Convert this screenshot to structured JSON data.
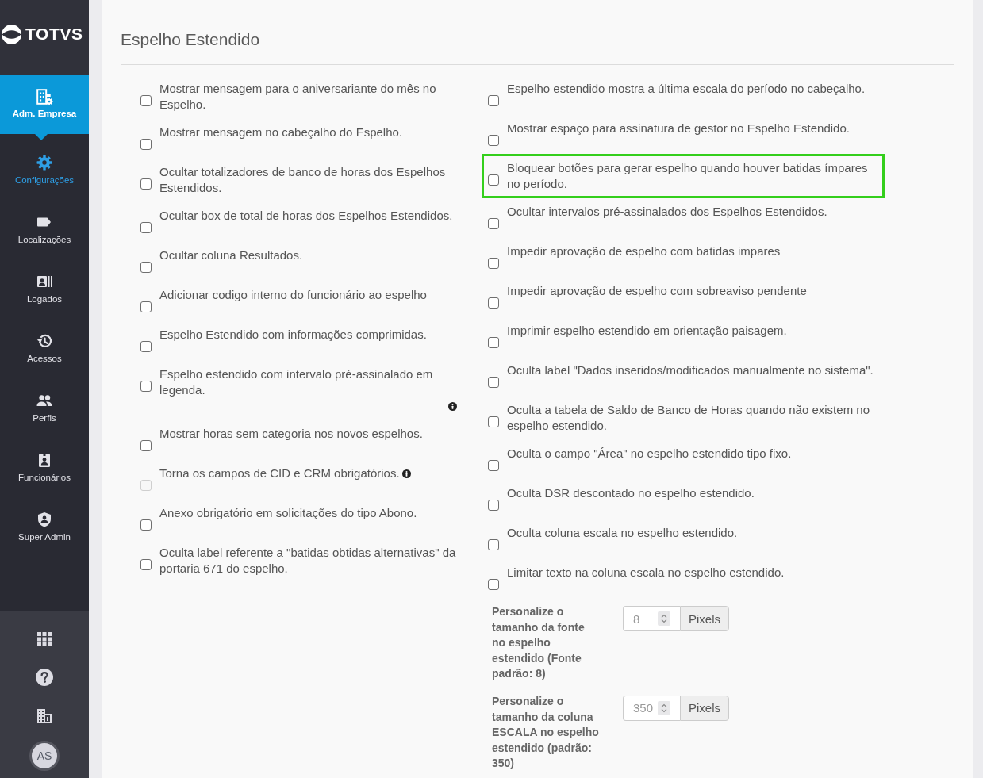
{
  "sidebar": {
    "logo": {
      "text": "TOTVS"
    },
    "section": {
      "label": "Adm. Empresa",
      "expanded": true
    },
    "items": [
      {
        "label": "Configurações",
        "selected": true
      },
      {
        "label": "Localizações",
        "selected": false
      },
      {
        "label": "Logados",
        "selected": false
      },
      {
        "label": "Acessos",
        "selected": false
      },
      {
        "label": "Perfis",
        "selected": false
      },
      {
        "label": "Funcionários",
        "selected": false
      },
      {
        "label": "Super Admin",
        "selected": false
      }
    ],
    "footer": {
      "avatar": "AS"
    }
  },
  "panel": {
    "title": "Espelho Estendido",
    "left_options": [
      {
        "label": "Mostrar mensagem para o aniversariante do mês no Espelho.",
        "checked": false,
        "disabled": false
      },
      {
        "label": "Mostrar mensagem no cabeçalho do Espelho.",
        "checked": false,
        "disabled": false
      },
      {
        "label": "Ocultar totalizadores de banco de horas dos Espelhos Estendidos.",
        "checked": false,
        "disabled": false
      },
      {
        "label": "Ocultar box de total de horas dos Espelhos Estendidos.",
        "checked": false,
        "disabled": false
      },
      {
        "label": "Ocultar coluna Resultados.",
        "checked": false,
        "disabled": false
      },
      {
        "label": "Adicionar codigo interno do funcionário ao espelho",
        "checked": false,
        "disabled": false
      },
      {
        "label": "Espelho Estendido com informações comprimidas.",
        "checked": false,
        "disabled": false
      },
      {
        "label": "Espelho estendido com intervalo pré-assinalado em legenda.",
        "checked": false,
        "disabled": false,
        "info_below": true
      },
      {
        "label": "Mostrar horas sem categoria nos novos espelhos.",
        "checked": false,
        "disabled": false
      },
      {
        "label": "Torna os campos de CID e CRM obrigatórios.",
        "checked": false,
        "disabled": true,
        "info_inline": true
      },
      {
        "label": "Anexo obrigatório em solicitações do tipo Abono.",
        "checked": false,
        "disabled": false
      },
      {
        "label": "Oculta label referente a \"batidas obtidas alternativas\" da portaria 671 do espelho.",
        "checked": false,
        "disabled": false
      }
    ],
    "right_options": [
      {
        "label": "Espelho estendido mostra a última escala do período no cabeçalho.",
        "checked": false,
        "disabled": false,
        "highlighted": false
      },
      {
        "label": "Mostrar espaço para assinatura de gestor no Espelho Estendido.",
        "checked": false,
        "disabled": false,
        "highlighted": false
      },
      {
        "label": "Bloquear botões para gerar espelho quando houver batidas ímpares no período.",
        "checked": false,
        "disabled": false,
        "highlighted": true
      },
      {
        "label": "Ocultar intervalos pré-assinalados dos Espelhos Estendidos.",
        "checked": false,
        "disabled": false,
        "highlighted": false
      },
      {
        "label": "Impedir aprovação de espelho com batidas impares",
        "checked": false,
        "disabled": false,
        "highlighted": false
      },
      {
        "label": "Impedir aprovação de espelho com sobreaviso pendente",
        "checked": false,
        "disabled": false,
        "highlighted": false
      },
      {
        "label": "Imprimir espelho estendido em orientação paisagem.",
        "checked": false,
        "disabled": false,
        "highlighted": false
      },
      {
        "label": "Oculta label \"Dados inseridos/modificados manualmente no sistema\".",
        "checked": false,
        "disabled": false,
        "highlighted": false
      },
      {
        "label": "Oculta a tabela de Saldo de Banco de Horas quando não existem no espelho estendido.",
        "checked": false,
        "disabled": false,
        "highlighted": false
      },
      {
        "label": "Oculta o campo \"Área\" no espelho estendido tipo fixo.",
        "checked": false,
        "disabled": false,
        "highlighted": false
      },
      {
        "label": "Oculta DSR descontado no espelho estendido.",
        "checked": false,
        "disabled": false,
        "highlighted": false
      },
      {
        "label": "Oculta coluna escala no espelho estendido.",
        "checked": false,
        "disabled": false,
        "highlighted": false
      },
      {
        "label": "Limitar texto na coluna escala no espelho estendido.",
        "checked": false,
        "disabled": false,
        "highlighted": false
      }
    ],
    "number_fields": [
      {
        "label": "Personalize o tamanho da fonte no espelho estendido (Fonte padrão: 8)",
        "value": "8",
        "unit": "Pixels"
      },
      {
        "label": "Personalize o tamanho da coluna ESCALA no espelho estendido (padrão: 350)",
        "value": "350",
        "unit": "Pixels"
      }
    ]
  }
}
